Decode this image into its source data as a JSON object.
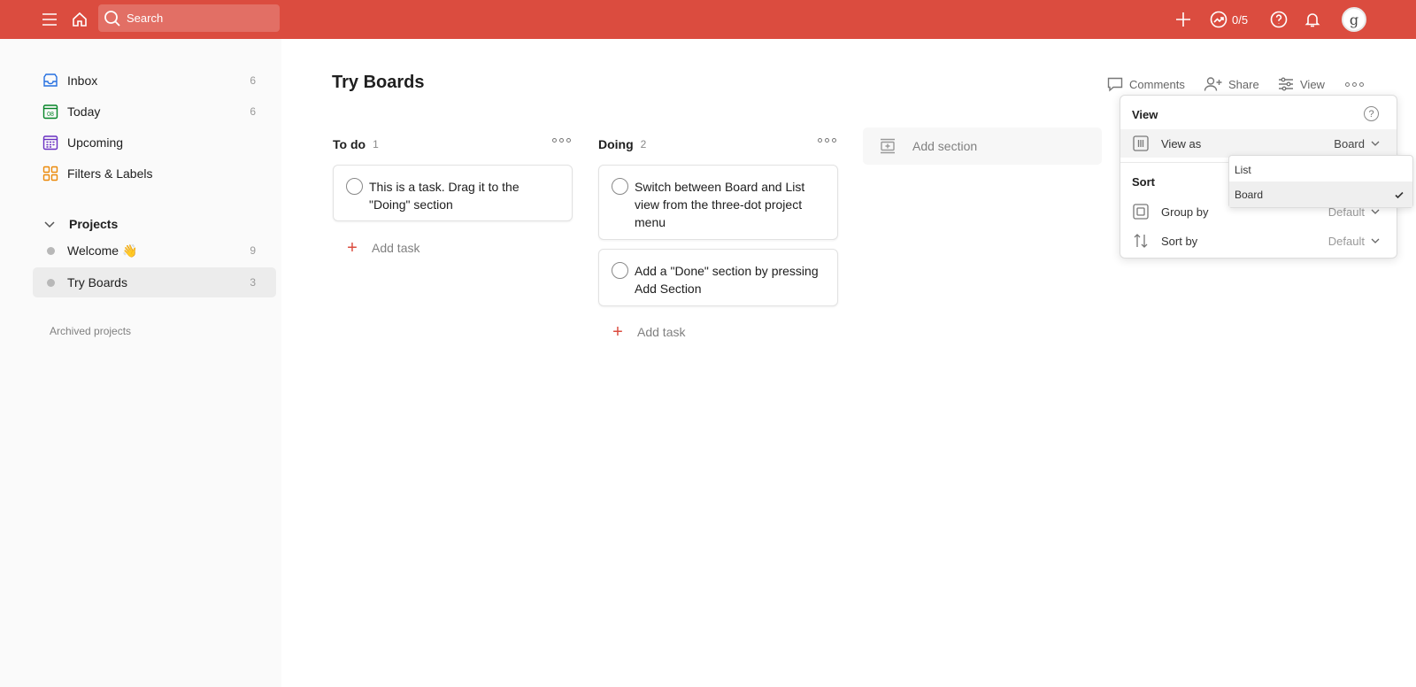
{
  "topbar": {
    "search_placeholder": "Search",
    "karma": "0/5",
    "avatar_initial": "g",
    "accent": "#db4c3f"
  },
  "sidebar": {
    "items": [
      {
        "label": "Inbox",
        "count": "6",
        "icon": "inbox-icon"
      },
      {
        "label": "Today",
        "count": "6",
        "icon": "calendar-today-icon",
        "icon_text": "08"
      },
      {
        "label": "Upcoming",
        "count": "",
        "icon": "calendar-upcoming-icon"
      },
      {
        "label": "Filters & Labels",
        "count": "",
        "icon": "filters-grid-icon"
      }
    ],
    "projects_label": "Projects",
    "projects": [
      {
        "label": "Welcome 👋",
        "count": "9"
      },
      {
        "label": "Try Boards",
        "count": "3",
        "active": true
      }
    ],
    "archived_label": "Archived projects"
  },
  "main": {
    "title": "Try Boards",
    "actions": {
      "comments": "Comments",
      "share": "Share",
      "view": "View"
    },
    "columns": [
      {
        "name": "To do",
        "count": "1",
        "tasks": [
          "This is a task. Drag it to the \"Doing\" section"
        ],
        "add_task": "Add task"
      },
      {
        "name": "Doing",
        "count": "2",
        "tasks": [
          "Switch between Board and List view from the three-dot project menu",
          "Add a \"Done\" section by pressing Add Section"
        ],
        "add_task": "Add task"
      }
    ],
    "add_section": "Add section"
  },
  "view_menu": {
    "title": "View",
    "help": "?",
    "view_as_label": "View as",
    "view_as_value": "Board",
    "sort_title": "Sort",
    "group_by_label": "Group by",
    "group_by_value": "Default",
    "sort_by_label": "Sort by",
    "sort_by_value": "Default",
    "options": [
      {
        "label": "List"
      },
      {
        "label": "Board",
        "selected": true
      }
    ]
  }
}
